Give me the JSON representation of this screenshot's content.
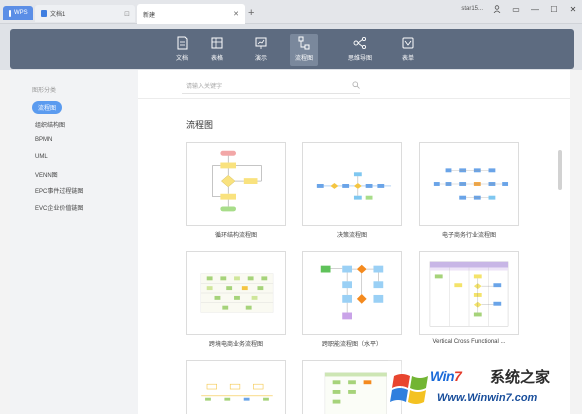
{
  "titlebar": {
    "tabs": [
      {
        "label": "WPS"
      },
      {
        "label": "文档1"
      },
      {
        "label": "新建"
      }
    ],
    "user": "star15..."
  },
  "toolbar": {
    "items": [
      {
        "label": "文档",
        "icon": "document-icon"
      },
      {
        "label": "表格",
        "icon": "table-icon"
      },
      {
        "label": "演示",
        "icon": "presentation-icon"
      },
      {
        "label": "流程图",
        "icon": "flowchart-icon",
        "active": true
      },
      {
        "label": "思维导图",
        "icon": "mindmap-icon"
      },
      {
        "label": "表单",
        "icon": "form-icon"
      }
    ]
  },
  "sidebar": {
    "title": "图形分类",
    "items": [
      {
        "label": "流程图",
        "active": true
      },
      {
        "label": "组织结构图"
      },
      {
        "label": "BPMN"
      },
      {
        "label": "UML"
      },
      {
        "label": "VENN图"
      },
      {
        "label": "EPC事件过程链图"
      },
      {
        "label": "EVC企业价值链图"
      }
    ]
  },
  "main": {
    "search_placeholder": "请输入关键字",
    "section_title": "流程图",
    "templates": [
      {
        "label": "循环结构流程图"
      },
      {
        "label": "决策流程图"
      },
      {
        "label": "电子商务行业流程图"
      },
      {
        "label": "跨境电商业务流程图"
      },
      {
        "label": "跨职能流程图（水平）"
      },
      {
        "label": "Vertical Cross Functional ..."
      }
    ]
  },
  "watermark": {
    "brand_a": "Win",
    "brand_b": "7",
    "cn": "系统之家",
    "url": "Www.Winwin7.com"
  },
  "colors": {
    "toolbar": "#5d6b80",
    "accent": "#5b9bef"
  }
}
